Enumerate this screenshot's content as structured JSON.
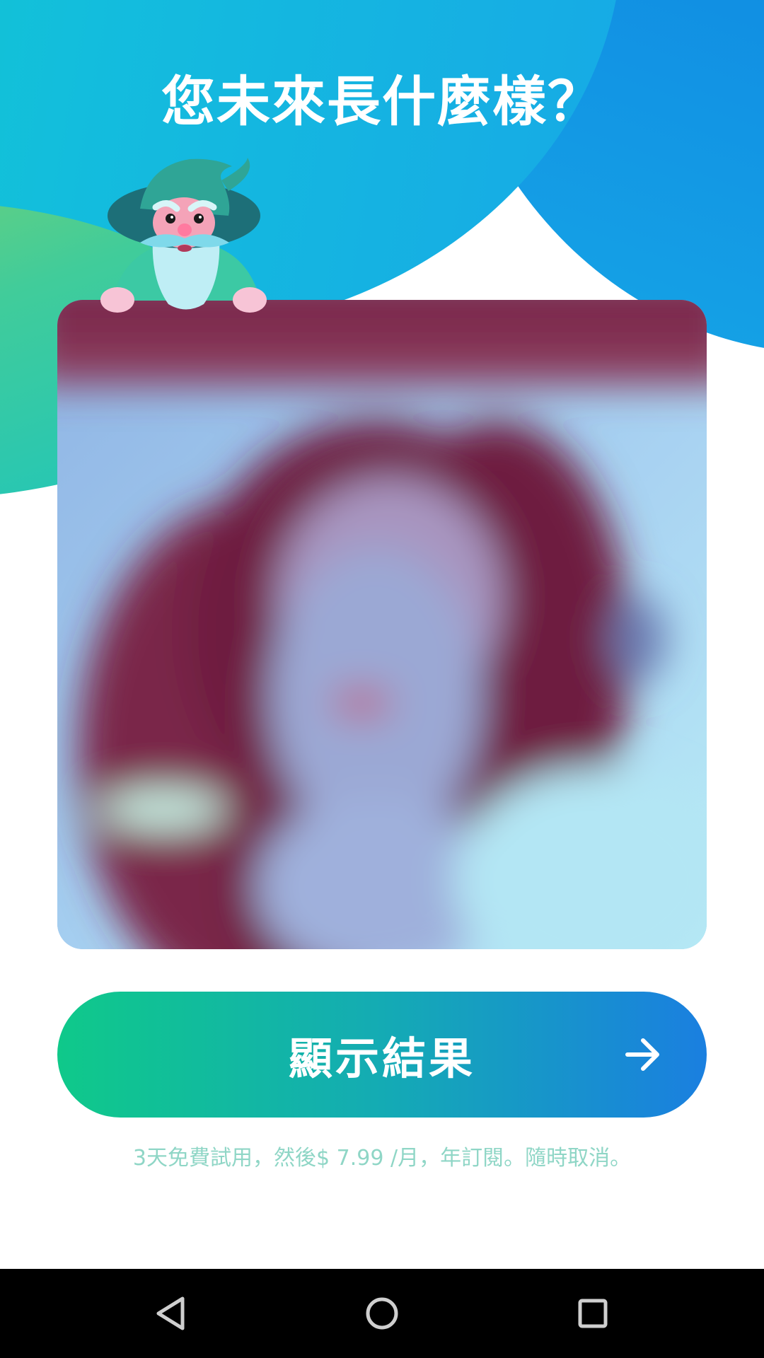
{
  "header": {
    "title": "您未來長什麼樣？"
  },
  "mascot": {
    "icon": "wizard-mascot-icon"
  },
  "preview": {
    "state": "blurred",
    "icon": "blurred-portrait-photo"
  },
  "cta": {
    "label": "顯示結果",
    "icon": "arrow-right-icon"
  },
  "terms": {
    "text": "3天免費試用，然後$ 7.99 /月，年訂閱。隨時取消。"
  },
  "navbar": {
    "back_icon": "back-triangle-icon",
    "home_icon": "home-circle-icon",
    "recent_icon": "recent-apps-square-icon"
  },
  "colors": {
    "gradient_start": "#0fc98a",
    "gradient_end": "#1a7fe0",
    "terms_text": "#8fd6c6"
  }
}
